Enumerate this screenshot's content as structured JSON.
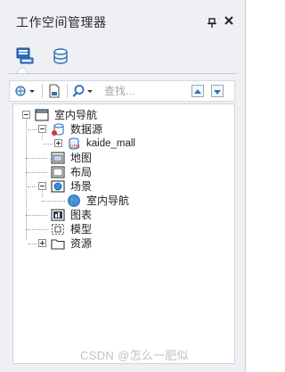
{
  "panel": {
    "title": "工作空间管理器",
    "pin_icon": "pin-icon",
    "close_icon": "close-icon",
    "close_glyph": "✕",
    "pin_glyph": "▪"
  },
  "tabs": [
    {
      "name": "workspace-tab",
      "icon": "workspace-icon",
      "selected": true
    },
    {
      "name": "datasource-tab",
      "icon": "database-icon",
      "selected": false
    }
  ],
  "toolbar": {
    "search_placeholder": "查找..."
  },
  "tree": {
    "root": "室内导航",
    "datasources": "数据源",
    "datasource_item": "kaide_mall",
    "maps": "地图",
    "layouts": "布局",
    "scenes": "场景",
    "scene_item": "室内导航",
    "charts": "图表",
    "models": "模型",
    "resources": "资源"
  },
  "colors": {
    "panel_bg": "#eef0f3",
    "accent_blue": "#2f6fbf",
    "tree_bg": "#ffffff"
  },
  "watermark": "CSDN @怎么一肥似"
}
